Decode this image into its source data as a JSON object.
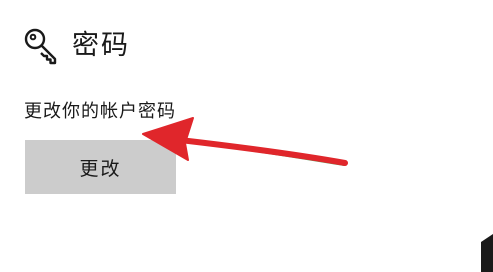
{
  "section": {
    "icon": "key-icon",
    "title": "密码"
  },
  "description": "更改你的帐户密码",
  "change_button": {
    "label": "更改"
  },
  "annotation": {
    "icon": "red-arrow",
    "color": "#e0262b"
  }
}
